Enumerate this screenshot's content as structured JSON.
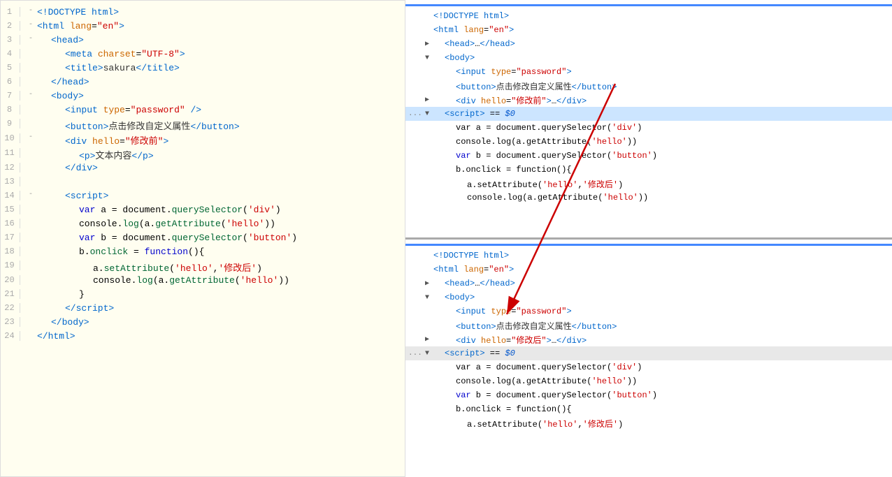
{
  "leftPanel": {
    "lines": [
      {
        "indent": 0,
        "collapse": "-",
        "html": "<span class='tag'>&lt;!DOCTYPE html&gt;</span>"
      },
      {
        "indent": 0,
        "collapse": "-",
        "html": "<span class='tag'>&lt;html</span> <span class='attr-name'>lang</span>=<span class='attr-val'>\"en\"</span><span class='tag'>&gt;</span>"
      },
      {
        "indent": 1,
        "collapse": "-",
        "html": "<span class='tag'>&lt;head&gt;</span>"
      },
      {
        "indent": 2,
        "collapse": "",
        "html": "<span class='tag'>&lt;meta</span> <span class='attr-name'>charset</span>=<span class='attr-val'>\"UTF-8\"</span><span class='tag'>&gt;</span>"
      },
      {
        "indent": 2,
        "collapse": "",
        "html": "<span class='tag'>&lt;title&gt;</span><span class='text-content'>sakura</span><span class='tag'>&lt;/title&gt;</span>"
      },
      {
        "indent": 1,
        "collapse": "",
        "html": "<span class='tag'>&lt;/head&gt;</span>"
      },
      {
        "indent": 1,
        "collapse": "-",
        "html": "<span class='tag'>&lt;body&gt;</span>"
      },
      {
        "indent": 2,
        "collapse": "",
        "html": "<span class='tag'>&lt;input</span> <span class='attr-name'>type</span>=<span class='attr-val'>\"password\"</span> <span class='tag'>/&gt;</span>"
      },
      {
        "indent": 2,
        "collapse": "",
        "html": "<span class='tag'>&lt;button&gt;</span><span class='text-content'>点击修改自定义属性</span><span class='tag'>&lt;/button&gt;</span>"
      },
      {
        "indent": 2,
        "collapse": "-",
        "html": "<span class='tag'>&lt;div</span> <span class='attr-name'>hello</span>=<span class='attr-val'>\"修改前\"</span><span class='tag'>&gt;</span>"
      },
      {
        "indent": 3,
        "collapse": "",
        "html": "<span class='tag'>&lt;p&gt;</span><span class='text-content'>文本内容</span><span class='tag'>&lt;/p&gt;</span>"
      },
      {
        "indent": 2,
        "collapse": "",
        "html": "<span class='tag'>&lt;/div&gt;</span>"
      },
      {
        "indent": 0,
        "collapse": "",
        "html": ""
      },
      {
        "indent": 2,
        "collapse": "-",
        "html": "<span class='tag'>&lt;script&gt;</span>"
      },
      {
        "indent": 3,
        "collapse": "",
        "html": "<span class='js-var'>var</span> a = document.<span class='js-method'>querySelector</span>(<span class='js-string'>'div'</span>)"
      },
      {
        "indent": 3,
        "collapse": "",
        "html": "console.<span class='js-method'>log</span>(a.<span class='js-method'>getAttribute</span>(<span class='js-string'>'hello'</span>))"
      },
      {
        "indent": 3,
        "collapse": "",
        "html": "<span class='js-var'>var</span> b = document.<span class='js-method'>querySelector</span>(<span class='js-string'>'button'</span>)"
      },
      {
        "indent": 3,
        "collapse": "",
        "html": "b.<span class='js-method'>onclick</span> = <span class='js-var'>function</span>(){"
      },
      {
        "indent": 4,
        "collapse": "",
        "html": "a.<span class='js-method'>setAttribute</span>(<span class='js-string'>'hello'</span>,<span class='js-string'>'修改后'</span>)"
      },
      {
        "indent": 4,
        "collapse": "",
        "html": "console.<span class='js-method'>log</span>(a.<span class='js-method'>getAttribute</span>(<span class='js-string'>'hello'</span>))"
      },
      {
        "indent": 3,
        "collapse": "",
        "html": "}"
      },
      {
        "indent": 2,
        "collapse": "",
        "html": "<span class='tag'>&lt;/script&gt;</span>"
      },
      {
        "indent": 1,
        "collapse": "",
        "html": "<span class='tag'>&lt;/body&gt;</span>"
      },
      {
        "indent": 0,
        "collapse": "",
        "html": "<span class='tag'>&lt;/html&gt;</span>"
      }
    ]
  },
  "topInspector": {
    "lines": [
      {
        "type": "normal",
        "indent": 0,
        "html": "<span class='tag'>&lt;!DOCTYPE html&gt;</span>"
      },
      {
        "type": "normal",
        "indent": 0,
        "html": "<span class='tag'>&lt;html</span> <span class='attr-name'>lang</span>=<span class='attr-val'>\"en\"</span><span class='tag'>&gt;</span>"
      },
      {
        "type": "normal",
        "indent": 1,
        "expand": "▶",
        "html": "<span class='tag'>&lt;head&gt;</span>…<span class='tag'>&lt;/head&gt;</span>"
      },
      {
        "type": "normal",
        "indent": 1,
        "expand": "▼",
        "html": "<span class='tag'>&lt;body&gt;</span>"
      },
      {
        "type": "normal",
        "indent": 2,
        "html": "<span class='tag'>&lt;input</span> <span class='attr-name'>type</span>=<span class='attr-val'>\"password\"</span><span class='tag'>&gt;</span>"
      },
      {
        "type": "normal",
        "indent": 2,
        "html": "<span class='tag'>&lt;button&gt;</span><span class='text-content'>点击修改自定义属性</span><span class='tag'>&lt;/button&gt;</span>"
      },
      {
        "type": "normal",
        "indent": 2,
        "expand": "▶",
        "html": "<span class='tag'>&lt;div</span> <span class='attr-name'>hello</span>=<span class='attr-val'>\"修改前\"</span><span class='tag'>&gt;</span>…<span class='tag'>&lt;/div&gt;</span>"
      },
      {
        "type": "selected",
        "indent": 1,
        "expand": "▼",
        "html": "<span class='tag'>&lt;script&gt;</span> == <span class='dollar-var'>$0</span>"
      },
      {
        "type": "normal",
        "indent": 2,
        "html": "var a = document.querySelector(<span class='js-string'>'div'</span>)"
      },
      {
        "type": "normal",
        "indent": 2,
        "html": "console.log(a.getAttribute(<span class='js-string'>'hello'</span>))"
      },
      {
        "type": "normal",
        "indent": 2,
        "html": "<span class='js-var'>var</span> b = document.querySelector(<span class='js-string'>'button'</span>)"
      },
      {
        "type": "normal",
        "indent": 2,
        "html": "b.onclick = function(){"
      },
      {
        "type": "normal",
        "indent": 3,
        "html": "a.setAttribute(<span class='js-string'>'hello'</span>,<span class='js-string'>'修改后'</span>)"
      },
      {
        "type": "normal",
        "indent": 3,
        "html": "console.log(a.getAttribute(<span class='js-string'>'hello'</span>))"
      }
    ]
  },
  "bottomInspector": {
    "lines": [
      {
        "type": "normal",
        "indent": 0,
        "html": "<span class='tag'>&lt;!DOCTYPE html&gt;</span>"
      },
      {
        "type": "normal",
        "indent": 0,
        "html": "<span class='tag'>&lt;html</span> <span class='attr-name'>lang</span>=<span class='attr-val'>\"en\"</span><span class='tag'>&gt;</span>"
      },
      {
        "type": "normal",
        "indent": 1,
        "expand": "▶",
        "html": "<span class='tag'>&lt;head&gt;</span>…<span class='tag'>&lt;/head&gt;</span>"
      },
      {
        "type": "normal",
        "indent": 1,
        "expand": "▼",
        "html": "<span class='tag'>&lt;body&gt;</span>"
      },
      {
        "type": "normal",
        "indent": 2,
        "html": "<span class='tag'>&lt;input</span> <span class='attr-name'>type</span>=<span class='attr-val'>\"password\"</span><span class='tag'>&gt;</span>"
      },
      {
        "type": "normal",
        "indent": 2,
        "html": "<span class='tag'>&lt;button&gt;</span><span class='text-content'>点击修改自定义属性</span><span class='tag'>&lt;/button&gt;</span>"
      },
      {
        "type": "normal",
        "indent": 2,
        "expand": "▶",
        "html": "<span class='tag'>&lt;div</span> <span class='attr-name'>hello</span>=<span class='attr-val'>\"修改后\"</span><span class='tag'>&gt;</span>…<span class='tag'>&lt;/div&gt;</span>"
      },
      {
        "type": "selected-bottom",
        "indent": 1,
        "expand": "▼",
        "html": "<span class='tag'>&lt;script&gt;</span> == <span class='dollar-var'>$0</span>"
      },
      {
        "type": "normal",
        "indent": 2,
        "html": "var a = document.querySelector(<span class='js-string'>'div'</span>)"
      },
      {
        "type": "normal",
        "indent": 2,
        "html": "console.log(a.getAttribute(<span class='js-string'>'hello'</span>))"
      },
      {
        "type": "normal",
        "indent": 2,
        "html": "<span class='js-var'>var</span> b = document.querySelector(<span class='js-string'>'button'</span>)"
      },
      {
        "type": "normal",
        "indent": 2,
        "html": "b.onclick = function(){"
      },
      {
        "type": "normal",
        "indent": 3,
        "html": "a.setAttribute(<span class='js-string'>'hello'</span>,<span class='js-string'>'修改后'</span>)"
      }
    ]
  }
}
